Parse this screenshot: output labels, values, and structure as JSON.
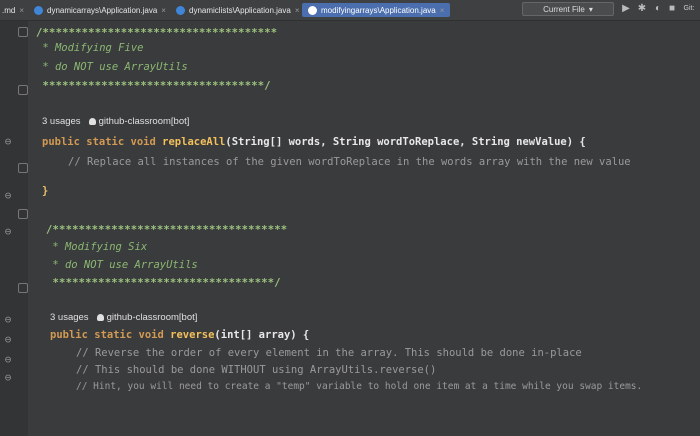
{
  "tabs": [
    {
      "label": ".md",
      "active": false
    },
    {
      "label": "dynamicarrays\\Application.java",
      "active": false
    },
    {
      "label": "dynamiclists\\Application.java",
      "active": false
    },
    {
      "label": "modifyingarrays\\Application.java",
      "active": true
    }
  ],
  "toolbar": {
    "current_file": "Current File",
    "git": "Git:"
  },
  "code": {
    "block1": {
      "open": "/************************************",
      "line1": " * Modifying Five",
      "line2": " * do NOT use ArrayUtils",
      "close": " **********************************/"
    },
    "method1": {
      "usages": "3 usages",
      "author": "github-classroom[bot]",
      "sig_public": "public",
      "sig_static": "static",
      "sig_void": "void",
      "sig_name": "replaceAll",
      "sig_params": "(String[] words, String wordToReplace, String newValue) {",
      "comment": "// Replace all instances of the given wordToReplace in the words array with the new value",
      "close": "}"
    },
    "block2": {
      "open": "/************************************",
      "line1": " * Modifying Six",
      "line2": " * do NOT use ArrayUtils",
      "close": " **********************************/"
    },
    "method2": {
      "usages": "3 usages",
      "author": "github-classroom[bot]",
      "sig_public": "public",
      "sig_static": "static",
      "sig_void": "void",
      "sig_name": "reverse",
      "sig_params": "(int[] array) {",
      "comment1": "// Reverse the order of every element in the array. This should be done in-place",
      "comment2": "// This should be done WITHOUT using ArrayUtils.reverse()",
      "comment3": "// Hint, you will need to create a \"temp\" variable to hold one item at a time while you swap items."
    }
  }
}
